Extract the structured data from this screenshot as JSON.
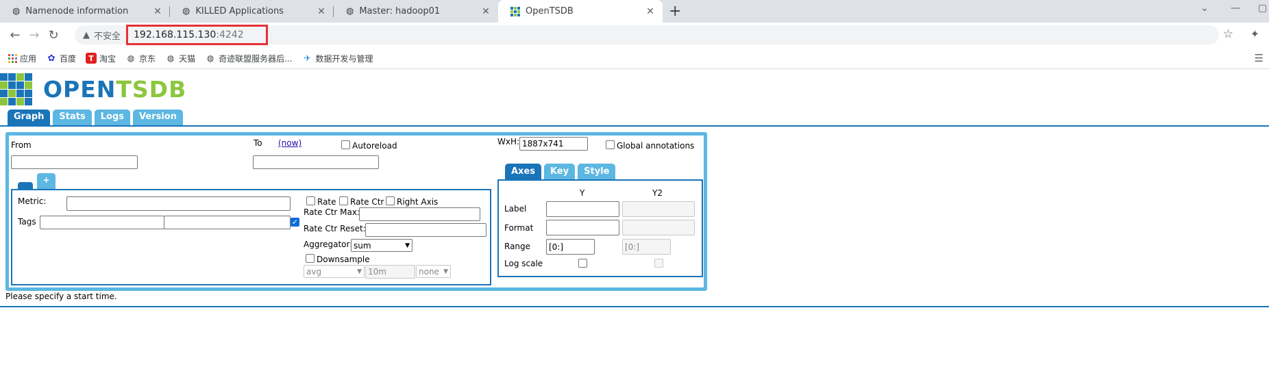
{
  "browser": {
    "tabs": [
      {
        "title": "Namenode information",
        "icon": "globe-icon"
      },
      {
        "title": "KILLED Applications",
        "icon": "globe-icon"
      },
      {
        "title": "Master: hadoop01",
        "icon": "globe-icon"
      },
      {
        "title": "OpenTSDB",
        "icon": "opentsdb-favicon"
      }
    ],
    "address": {
      "security_label": "不安全",
      "host": "192.168.115.130",
      "port": ":4242"
    },
    "bookmarks": [
      {
        "label": "应用",
        "icon": "apps-icon"
      },
      {
        "label": "百度",
        "icon": "baidu-icon"
      },
      {
        "label": "淘宝",
        "icon": "taobao-icon"
      },
      {
        "label": "京东",
        "icon": "globe-icon"
      },
      {
        "label": "天猫",
        "icon": "globe-icon"
      },
      {
        "label": "奇迹联盟服务器后...",
        "icon": "globe-icon"
      },
      {
        "label": "数据开发与管理",
        "icon": "bird-icon"
      }
    ]
  },
  "page": {
    "logo": {
      "part1": "OPEN",
      "part2": "TSDB"
    },
    "main_tabs": [
      "Graph",
      "Stats",
      "Logs",
      "Version"
    ],
    "graph": {
      "from_label": "From",
      "from_value": "",
      "to_label": "To",
      "now_link": "(now)",
      "to_value": "",
      "autoreload_label": "Autoreload",
      "wxh_label": "WxH:",
      "wxh_value": "1887x741",
      "global_annotations_label": "Global annotations",
      "query_tabs": [
        "",
        "+"
      ],
      "metric": {
        "metric_label": "Metric:",
        "metric_value": "",
        "tags_label": "Tags",
        "tag_key": "",
        "tag_value": "",
        "rate_label": "Rate",
        "rate_ctr_label": "Rate Ctr",
        "right_axis_label": "Right Axis",
        "rate_ctr_max_label": "Rate Ctr Max:",
        "rate_ctr_reset_label": "Rate Ctr Reset:",
        "aggregator_label": "Aggregator:",
        "aggregator_value": "sum",
        "downsample_label": "Downsample",
        "downsample_func": "avg",
        "downsample_interval": "10m",
        "downsample_fill": "none"
      },
      "axes_tabs": [
        "Axes",
        "Key",
        "Style"
      ],
      "axes": {
        "col_y": "Y",
        "col_y2": "Y2",
        "label_row": "Label",
        "format_row": "Format",
        "range_row": "Range",
        "range_y": "[0:]",
        "range_y2": "[0:]",
        "log_scale_row": "Log scale"
      },
      "status": "Please specify a start time."
    }
  },
  "colors": {
    "accent_dark": "#1a74b8",
    "accent_light": "#5cb7e2",
    "logo_green": "#8cc63e",
    "url_highlight": "#e5303a"
  }
}
